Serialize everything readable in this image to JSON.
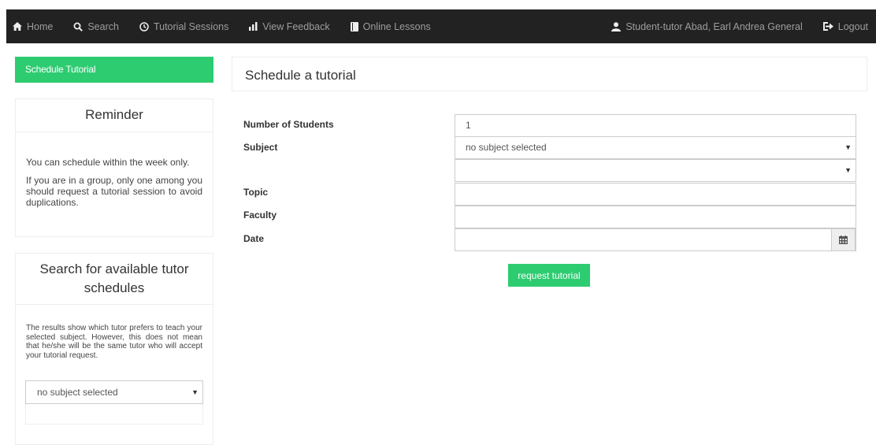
{
  "navbar": {
    "left": [
      {
        "label": "Home",
        "icon": "home-icon"
      },
      {
        "label": "Search",
        "icon": "search-icon"
      },
      {
        "label": "Tutorial Sessions",
        "icon": "clock-icon"
      },
      {
        "label": "View Feedback",
        "icon": "bar-chart-icon"
      },
      {
        "label": "Online Lessons",
        "icon": "book-icon"
      }
    ],
    "user_label": "Student-tutor Abad, Earl Andrea General",
    "logout_label": "Logout"
  },
  "sidebar": {
    "schedule_button": "Schedule Tutorial",
    "reminder": {
      "title": "Reminder",
      "text1": "You can schedule within the week only.",
      "text2": "If you are in a group, only one among you should request a tutorial session to avoid duplications."
    },
    "search": {
      "title": "Search for available tutor schedules",
      "text": "The results show which tutor prefers to teach your selected subject. However, this does not mean that he/she will be the same tutor who will accept your tutorial request.",
      "select_value": "no subject selected"
    }
  },
  "main": {
    "title": "Schedule a tutorial",
    "form": {
      "students_label": "Number of Students",
      "students_value": "1",
      "subject_label": "Subject",
      "subject_value": "no subject selected",
      "sub_select_value": "",
      "topic_label": "Topic",
      "topic_value": "",
      "faculty_label": "Faculty",
      "faculty_value": "",
      "date_label": "Date",
      "date_value": ""
    },
    "request_button": "request tutorial"
  },
  "colors": {
    "accent": "#2ecc71",
    "navbar_bg": "#222222"
  }
}
